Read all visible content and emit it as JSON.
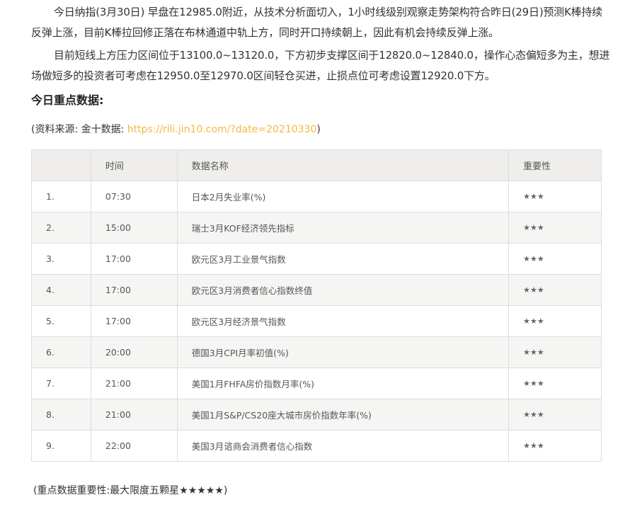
{
  "article": {
    "paragraph1": "今日纳指(3月30日) 早盘在12985.0附近，从技术分析面切入，1小时线级别观察走势架构符合昨日(29日)预测K棒持续反弹上涨，目前K棒拉回修正落在布林通道中轨上方，同时开口持续朝上，因此有机会持续反弹上涨。",
    "paragraph2": "目前短线上方压力区间位于13100.0~13120.0，下方初步支撑区间于12820.0~12840.0，操作心态偏短多为主，想进场做短多的投资者可考虑在12950.0至12970.0区间轻仓买进，止损点位可考虑设置12920.0下方。"
  },
  "section": {
    "heading": "今日重点数据:"
  },
  "source": {
    "prefix": "(资料来源: 金十数据: ",
    "link_text": "https://rili.jin10.com/?date=20210330",
    "suffix": ")"
  },
  "table": {
    "headers": {
      "index": "",
      "time": "时间",
      "name": "数据名称",
      "importance": "重要性"
    },
    "rows": [
      {
        "index": "1.",
        "time": "07:30",
        "name": "日本2月失业率(%)",
        "importance": "★★★"
      },
      {
        "index": "2.",
        "time": "15:00",
        "name": "瑞士3月KOF经济领先指标",
        "importance": "★★★"
      },
      {
        "index": "3.",
        "time": "17:00",
        "name": "欧元区3月工业景气指数",
        "importance": "★★★"
      },
      {
        "index": "4.",
        "time": "17:00",
        "name": "欧元区3月消费者信心指数终值",
        "importance": "★★★"
      },
      {
        "index": "5.",
        "time": "17:00",
        "name": "欧元区3月经济景气指数",
        "importance": "★★★"
      },
      {
        "index": "6.",
        "time": "20:00",
        "name": "德国3月CPI月率初值(%)",
        "importance": "★★★"
      },
      {
        "index": "7.",
        "time": "21:00",
        "name": "美国1月FHFA房价指数月率(%)",
        "importance": "★★★"
      },
      {
        "index": "8.",
        "time": "21:00",
        "name": "美国1月S&P/CS20座大城市房价指数年率(%)",
        "importance": "★★★"
      },
      {
        "index": "9.",
        "time": "22:00",
        "name": "美国3月谘商会消费者信心指数",
        "importance": "★★★"
      }
    ]
  },
  "footnote": {
    "text": "(重点数据重要性:最大限度五颗星★★★★★)"
  },
  "colors": {
    "link": "#f5b942",
    "header_bg": "#efeeec",
    "stripe_bg": "#f5f5f4",
    "border": "#dddddd"
  }
}
